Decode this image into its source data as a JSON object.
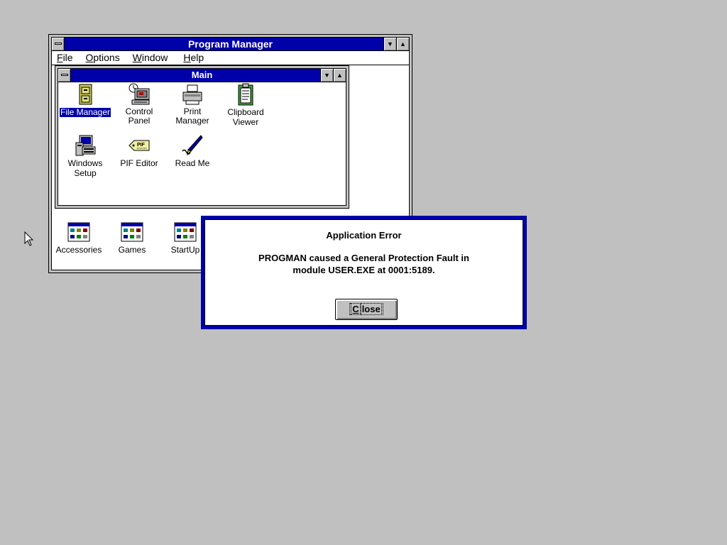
{
  "program_manager": {
    "title": "Program Manager",
    "menu": [
      {
        "label": "File",
        "accel": "F",
        "rest": "ile"
      },
      {
        "label": "Options",
        "accel": "O",
        "rest": "ptions"
      },
      {
        "label": "Window",
        "accel": "W",
        "rest": "indow"
      },
      {
        "label": "Help",
        "accel": "H",
        "rest": "elp"
      }
    ]
  },
  "main_group": {
    "title": "Main",
    "icons": [
      {
        "label": "File Manager",
        "icon": "file-cabinet-icon",
        "selected": true
      },
      {
        "label": "Control Panel",
        "icon": "control-panel-icon"
      },
      {
        "label": "Print Manager",
        "icon": "printer-icon"
      },
      {
        "label": "Clipboard Viewer",
        "line1": "Clipboard",
        "line2": "Viewer",
        "icon": "clipboard-icon"
      },
      {
        "label": "Windows Setup",
        "line1": "Windows",
        "line2": "Setup",
        "icon": "windows-setup-icon"
      },
      {
        "label": "PIF Editor",
        "icon": "pif-tag-icon"
      },
      {
        "label": "Read Me",
        "icon": "pen-icon"
      }
    ]
  },
  "minimized_groups": [
    {
      "label": "Accessories",
      "icon": "program-group-icon"
    },
    {
      "label": "Games",
      "icon": "program-group-icon"
    },
    {
      "label": "StartUp",
      "icon": "program-group-icon"
    }
  ],
  "error_dialog": {
    "title": "Application Error",
    "line1": "PROGMAN caused a General Protection Fault in",
    "line2": "module USER.EXE at 0001:5189.",
    "button": {
      "label": "Close",
      "accel": "C",
      "rest": "lose"
    }
  },
  "pif_badge": "PIF"
}
